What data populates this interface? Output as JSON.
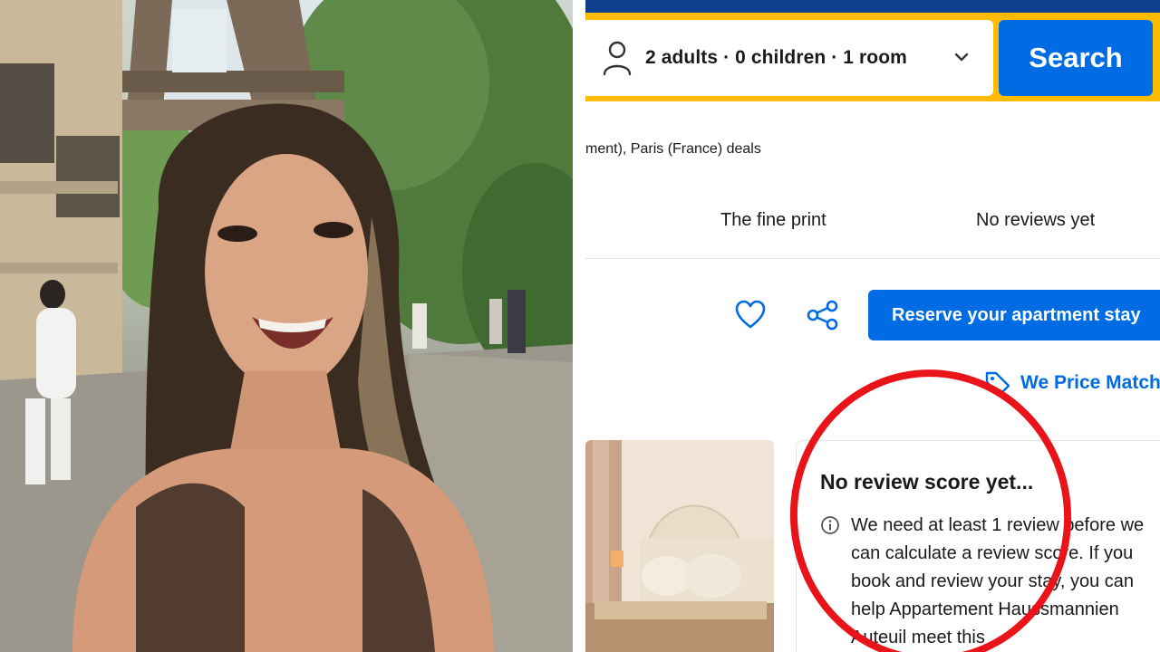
{
  "photo": {
    "subject": "selfie-photo"
  },
  "search_bar": {
    "occupancy_label": "2 adults · 0 children · 1 room",
    "search_label": "Search"
  },
  "deals_text": "ment), Paris (France) deals",
  "tabs": [
    {
      "label": "The fine print"
    },
    {
      "label": "No reviews yet"
    }
  ],
  "actions": {
    "reserve_label": "Reserve your apartment stay",
    "price_match_label": "We Price Match"
  },
  "review": {
    "title": "No review score yet...",
    "body": "We need at least 1 review before we can calculate a review score. If you book and review your stay, you can help Appartement Haussmannien Auteuil meet this"
  },
  "icons": {
    "person": "person-icon",
    "chevron": "chevron-down-icon",
    "heart": "heart-icon",
    "share": "share-icon",
    "tag": "price-tag-icon",
    "info": "info-icon"
  },
  "colors": {
    "brand_blue": "#006ce4",
    "header_navy": "#0f3f8f",
    "search_yellow": "#febb02",
    "annotation_red": "#e8141a"
  }
}
